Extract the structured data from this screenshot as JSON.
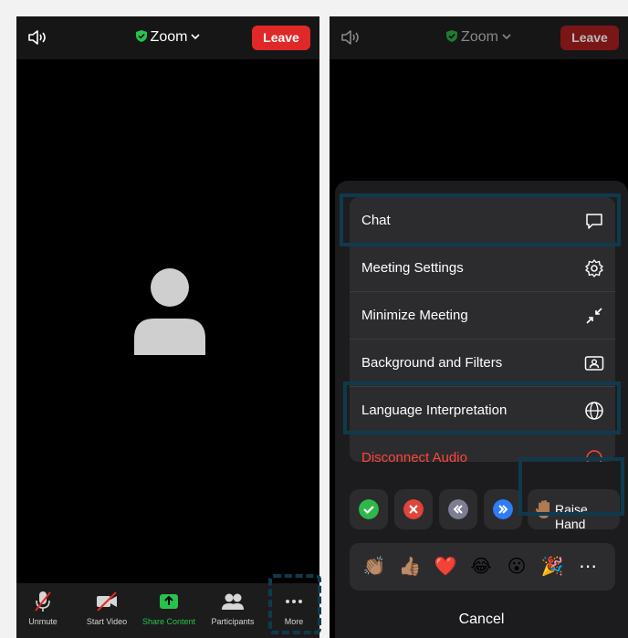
{
  "left_screen": {
    "title": "Zoom",
    "leave_label": "Leave",
    "toolbar": [
      {
        "label": "Unmute",
        "icon": "muted-mic-icon"
      },
      {
        "label": "Start Video",
        "icon": "video-off-icon"
      },
      {
        "label": "Share Content",
        "icon": "share-up-arrow-icon"
      },
      {
        "label": "Participants",
        "icon": "participants-icon"
      },
      {
        "label": "More",
        "icon": "ellipsis-icon"
      }
    ]
  },
  "right_screen": {
    "title": "Zoom",
    "leave_label": "Leave",
    "menu": [
      {
        "label": "Chat",
        "icon": "chat-bubble-icon"
      },
      {
        "label": "Meeting Settings",
        "icon": "gear-icon"
      },
      {
        "label": "Minimize Meeting",
        "icon": "minimize-arrows-icon"
      },
      {
        "label": "Background and Filters",
        "icon": "portrait-frame-icon"
      },
      {
        "label": "Language Interpretation",
        "icon": "globe-icon"
      },
      {
        "label": "Disconnect Audio",
        "icon": "disconnect-icon"
      }
    ],
    "quick_actions": [
      {
        "name": "yes",
        "icon": "check-icon",
        "color": "#2fb84a"
      },
      {
        "name": "no",
        "icon": "x-icon",
        "color": "#e0443a"
      },
      {
        "name": "slower",
        "icon": "double-left-icon",
        "color": "#7d7d94"
      },
      {
        "name": "faster",
        "icon": "double-right-icon",
        "color": "#2f7cf6"
      }
    ],
    "raise_hand_label": "Raise Hand",
    "reactions": [
      "👏🏽",
      "👍🏽",
      "❤️",
      "😂",
      "😮",
      "🎉",
      "⋯"
    ],
    "cancel_label": "Cancel"
  },
  "colors": {
    "leave_red": "#e02828",
    "share_green": "#27c24c",
    "highlight_box": "#0f3a4d",
    "sheet_bg": "#1c1c1e",
    "cell_bg": "#2c2c2e"
  }
}
